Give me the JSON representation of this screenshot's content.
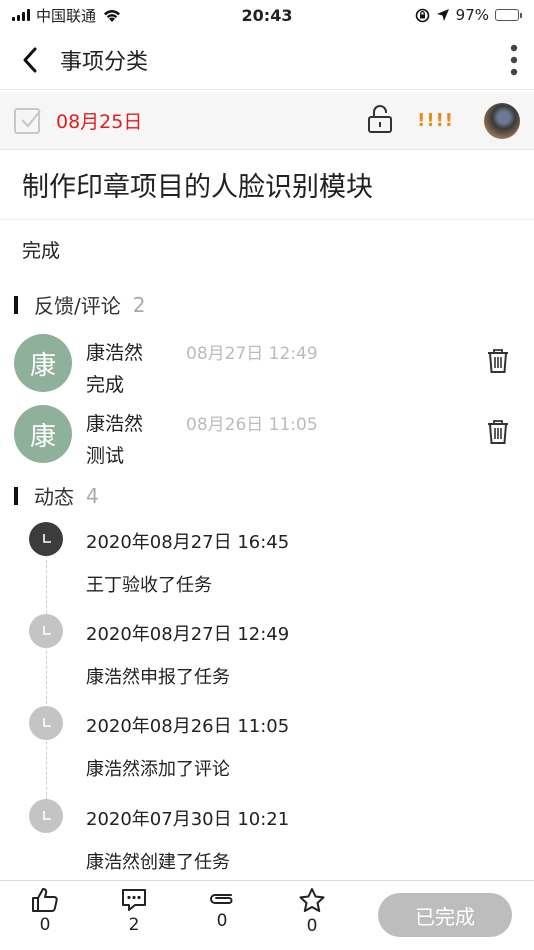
{
  "status_bar": {
    "carrier": "中国联通",
    "time": "20:43",
    "battery_percent": "97%",
    "battery_level": 0.97
  },
  "nav": {
    "title": "事项分类"
  },
  "task": {
    "due_date": "08月25日",
    "priority": "!!!!",
    "title": "制作印章项目的人脸识别模块",
    "status": "完成"
  },
  "feedback": {
    "title": "反馈/评论",
    "count": "2",
    "comments": [
      {
        "avatar_char": "康",
        "author": "康浩然",
        "time": "08月27日 12:49",
        "text": "完成"
      },
      {
        "avatar_char": "康",
        "author": "康浩然",
        "time": "08月26日 11:05",
        "text": "测试"
      }
    ]
  },
  "activity": {
    "title": "动态",
    "count": "4",
    "items": [
      {
        "time": "2020年08月27日 16:45",
        "text": "王丁验收了任务",
        "active": true
      },
      {
        "time": "2020年08月27日 12:49",
        "text": "康浩然申报了任务",
        "active": false
      },
      {
        "time": "2020年08月26日 11:05",
        "text": "康浩然添加了评论",
        "active": false
      },
      {
        "time": "2020年07月30日 10:21",
        "text": "康浩然创建了任务",
        "active": false
      }
    ]
  },
  "bottom_bar": {
    "likes": "0",
    "comments": "2",
    "attachments": "0",
    "favorites": "0",
    "done_label": "已完成"
  },
  "colors": {
    "accent_red": "#e02020",
    "priority_orange": "#e6901a",
    "avatar_green": "#8fb09a",
    "battery_green": "#4cd964"
  }
}
